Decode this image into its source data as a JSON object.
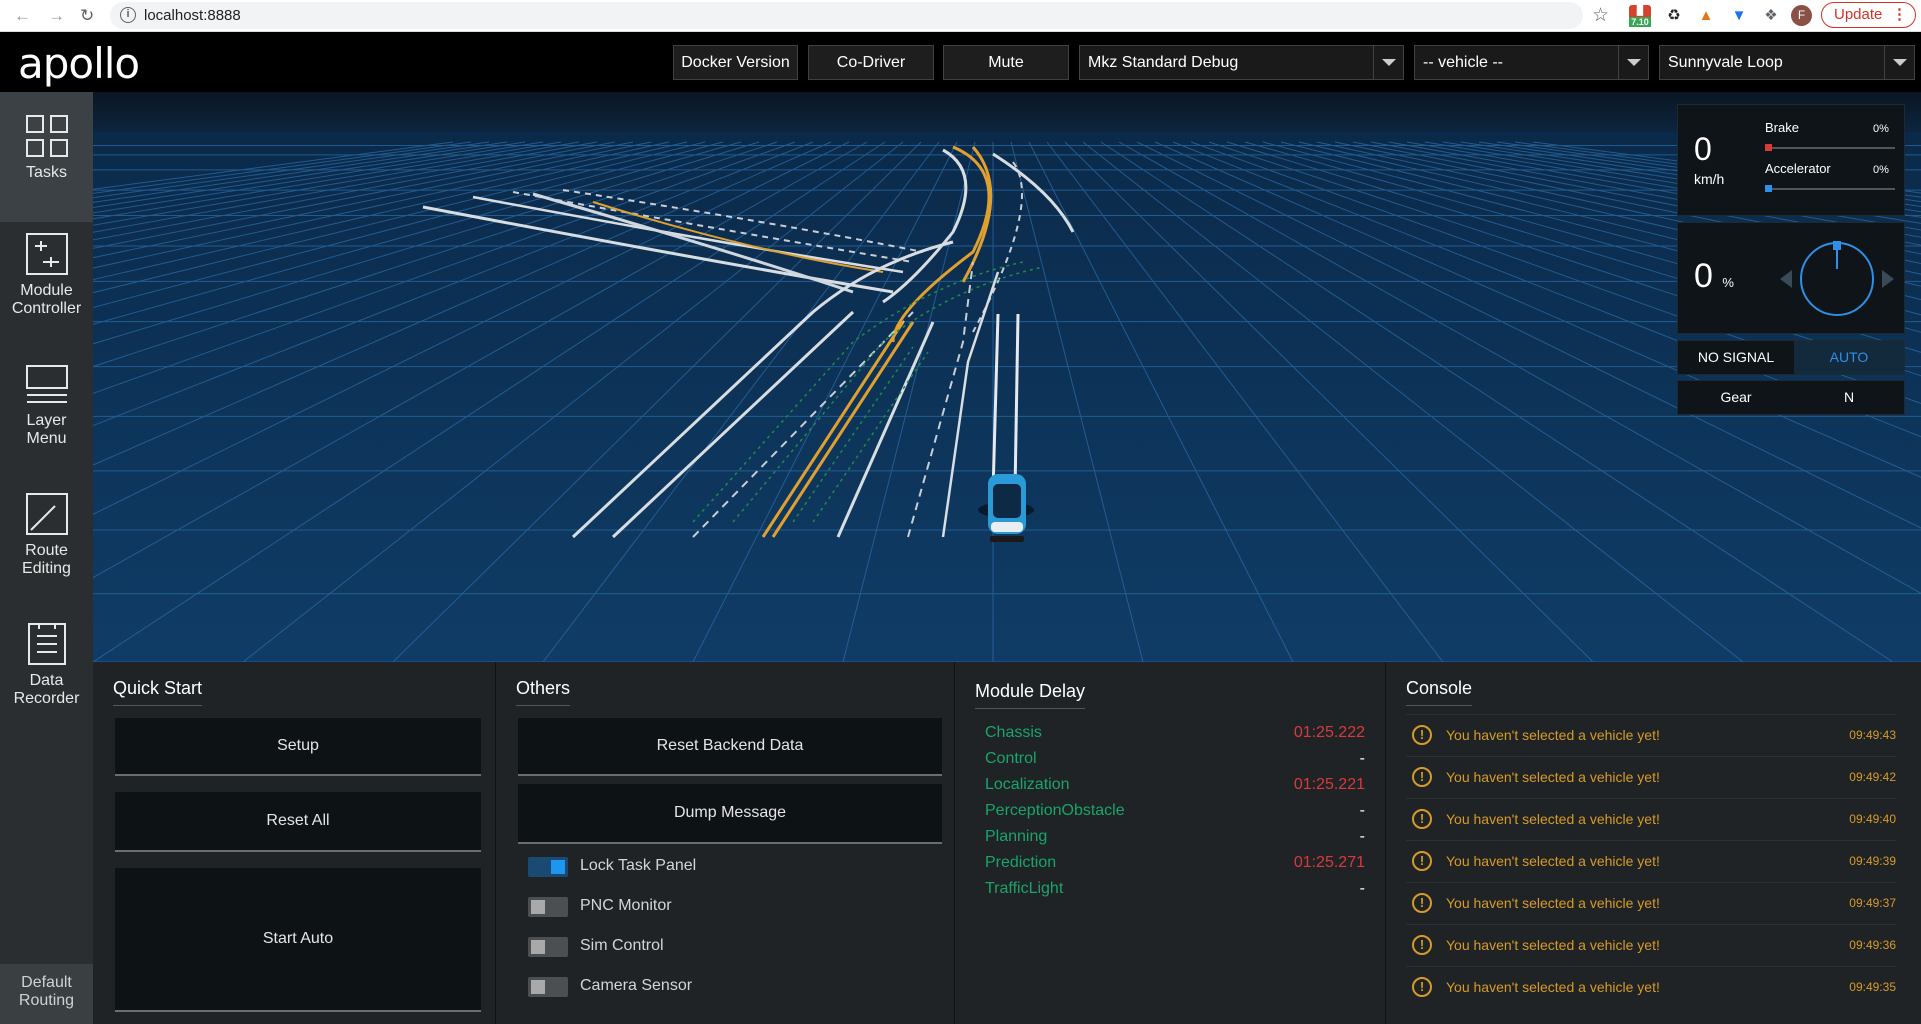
{
  "browser": {
    "url": "localhost:8888",
    "ext_badge_number": "7.10",
    "avatar_letter": "F",
    "update_label": "Update"
  },
  "header": {
    "logo": "apollo",
    "docker_version": "Docker Version",
    "co_driver": "Co-Driver",
    "mute": "Mute",
    "mode_select": "Mkz Standard Debug",
    "vehicle_select": "-- vehicle --",
    "map_select": "Sunnyvale Loop"
  },
  "sidebar": {
    "items": [
      {
        "label_line1": "Tasks",
        "label_line2": "",
        "icon": "grid-icon"
      },
      {
        "label_line1": "Module",
        "label_line2": "Controller",
        "icon": "sliders-icon"
      },
      {
        "label_line1": "Layer",
        "label_line2": "Menu",
        "icon": "layers-icon"
      },
      {
        "label_line1": "Route",
        "label_line2": "Editing",
        "icon": "route-icon"
      },
      {
        "label_line1": "Data",
        "label_line2": "Recorder",
        "icon": "document-icon"
      }
    ],
    "default_routing_line1": "Default",
    "default_routing_line2": "Routing"
  },
  "dashboard": {
    "speed": "0",
    "speed_unit": "km/h",
    "brake_label": "Brake",
    "brake_pct": "0%",
    "accel_label": "Accelerator",
    "accel_pct": "0%",
    "steering": "0",
    "steering_unit": "%",
    "signal": "NO SIGNAL",
    "driving_mode": "AUTO",
    "gear_label": "Gear",
    "gear_value": "N",
    "colors": {
      "brake": "#d83a3a",
      "accel": "#2f8ee6"
    }
  },
  "quick_start": {
    "title": "Quick Start",
    "setup": "Setup",
    "reset_all": "Reset All",
    "start_auto": "Start Auto"
  },
  "others": {
    "title": "Others",
    "reset_backend": "Reset Backend Data",
    "dump_message": "Dump Message",
    "toggles": [
      {
        "label": "Lock Task Panel",
        "on": true
      },
      {
        "label": "PNC Monitor",
        "on": false
      },
      {
        "label": "Sim Control",
        "on": false
      },
      {
        "label": "Camera Sensor",
        "on": false
      }
    ]
  },
  "module_delay": {
    "title": "Module Delay",
    "rows": [
      {
        "name": "Chassis",
        "value": "01:25.222"
      },
      {
        "name": "Control",
        "value": "-"
      },
      {
        "name": "Localization",
        "value": "01:25.221"
      },
      {
        "name": "PerceptionObstacle",
        "value": "-"
      },
      {
        "name": "Planning",
        "value": "-"
      },
      {
        "name": "Prediction",
        "value": "01:25.271"
      },
      {
        "name": "TrafficLight",
        "value": "-"
      }
    ]
  },
  "console": {
    "title": "Console",
    "messages": [
      {
        "text": "You haven't selected a vehicle yet!",
        "time": "09:49:43"
      },
      {
        "text": "You haven't selected a vehicle yet!",
        "time": "09:49:42"
      },
      {
        "text": "You haven't selected a vehicle yet!",
        "time": "09:49:40"
      },
      {
        "text": "You haven't selected a vehicle yet!",
        "time": "09:49:39"
      },
      {
        "text": "You haven't selected a vehicle yet!",
        "time": "09:49:37"
      },
      {
        "text": "You haven't selected a vehicle yet!",
        "time": "09:49:36"
      },
      {
        "text": "You haven't selected a vehicle yet!",
        "time": "09:49:35"
      }
    ]
  }
}
